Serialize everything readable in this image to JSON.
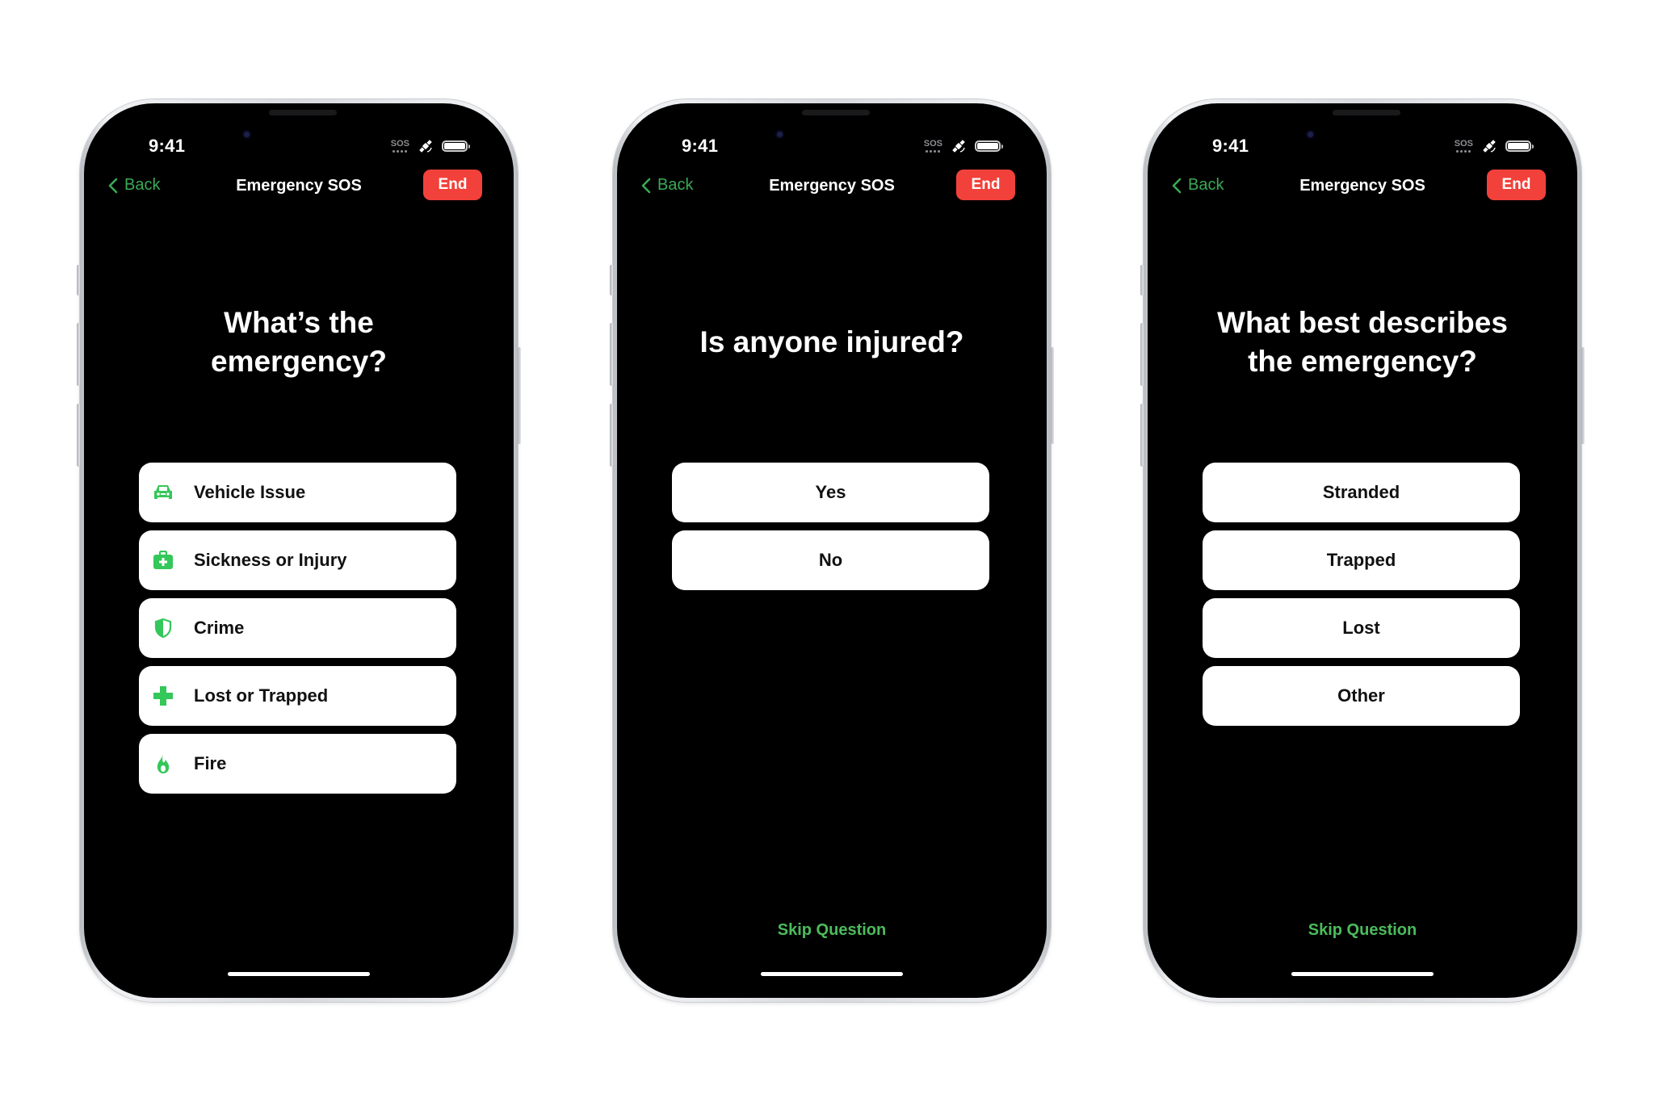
{
  "colors": {
    "accent_green": "#34c759",
    "link_green": "#4cbb5c",
    "end_red": "#f2413a",
    "screen_bg": "#000000",
    "option_bg": "#ffffff"
  },
  "phones": [
    {
      "status": {
        "time": "9:41",
        "sos_label": "SOS",
        "icons": [
          "sos-signal-icon",
          "satellite-icon",
          "battery-icon"
        ]
      },
      "nav": {
        "back_label": "Back",
        "title": "Emergency SOS",
        "end_label": "End"
      },
      "question_lines": [
        "What’s the",
        "emergency?"
      ],
      "options": [
        {
          "label": "Vehicle Issue",
          "icon": "car-icon"
        },
        {
          "label": "Sickness or Injury",
          "icon": "medical-bag-icon"
        },
        {
          "label": "Crime",
          "icon": "shield-icon"
        },
        {
          "label": "Lost or Trapped",
          "icon": "cross-icon"
        },
        {
          "label": "Fire",
          "icon": "flame-icon"
        }
      ]
    },
    {
      "status": {
        "time": "9:41",
        "sos_label": "SOS",
        "icons": [
          "sos-signal-icon",
          "satellite-icon",
          "battery-icon"
        ]
      },
      "nav": {
        "back_label": "Back",
        "title": "Emergency SOS",
        "end_label": "End"
      },
      "question_lines": [
        "Is anyone injured?"
      ],
      "options": [
        {
          "label": "Yes"
        },
        {
          "label": "No"
        }
      ],
      "skip_label": "Skip Question"
    },
    {
      "status": {
        "time": "9:41",
        "sos_label": "SOS",
        "icons": [
          "sos-signal-icon",
          "satellite-icon",
          "battery-icon"
        ]
      },
      "nav": {
        "back_label": "Back",
        "title": "Emergency SOS",
        "end_label": "End"
      },
      "question_lines": [
        "What best describes",
        "the emergency?"
      ],
      "options": [
        {
          "label": "Stranded"
        },
        {
          "label": "Trapped"
        },
        {
          "label": "Lost"
        },
        {
          "label": "Other"
        }
      ],
      "skip_label": "Skip Question"
    }
  ]
}
